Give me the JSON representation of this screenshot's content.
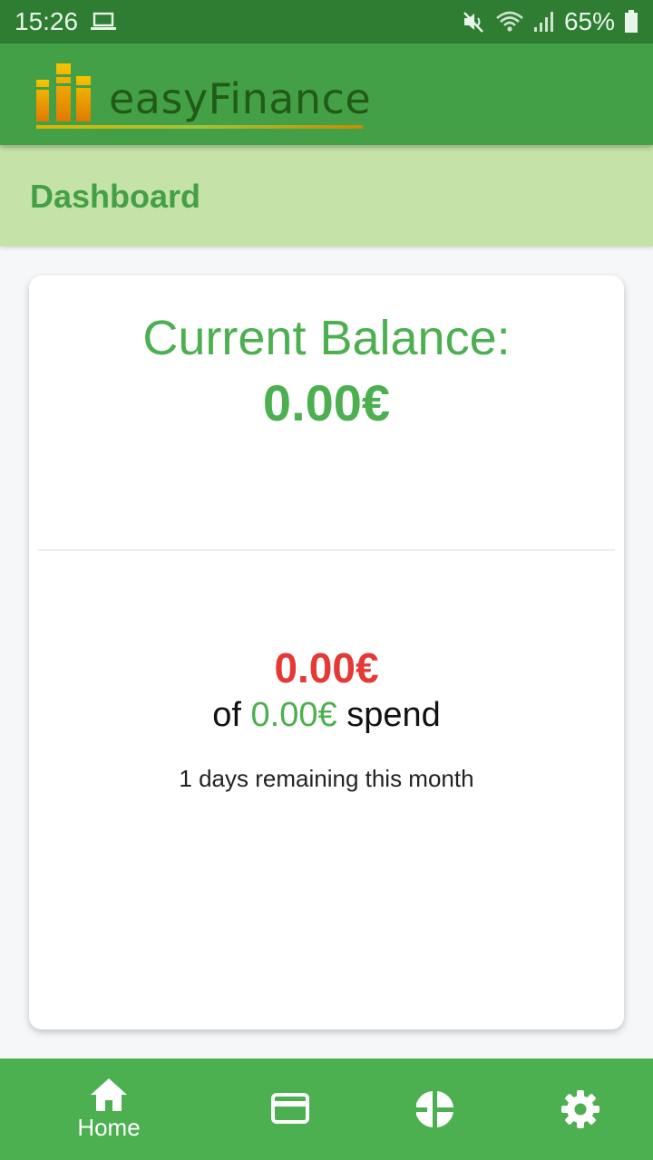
{
  "status_bar": {
    "time": "15:26",
    "battery": "65%",
    "icons": [
      "laptop-icon",
      "mute-icon",
      "wifi-icon",
      "signal-icon",
      "battery-icon"
    ]
  },
  "app": {
    "name": "easyFinance",
    "colors": {
      "primary": "#43a047",
      "dark": "#2e7d32",
      "light": "#c5e3a9",
      "negative": "#e53935"
    }
  },
  "page": {
    "title": "Dashboard"
  },
  "balance": {
    "label": "Current Balance:",
    "value": "0.00€"
  },
  "budget": {
    "spent": "0.00€",
    "prefix": "of",
    "total": "0.00€",
    "suffix": "spend",
    "days_remaining": "1 days remaining this month"
  },
  "bottom_nav": {
    "items": [
      {
        "icon": "home-icon",
        "label": "Home",
        "active": true
      },
      {
        "icon": "credit-card-icon",
        "label": "",
        "active": false
      },
      {
        "icon": "pie-chart-icon",
        "label": "",
        "active": false
      },
      {
        "icon": "settings-icon",
        "label": "",
        "active": false
      }
    ]
  }
}
